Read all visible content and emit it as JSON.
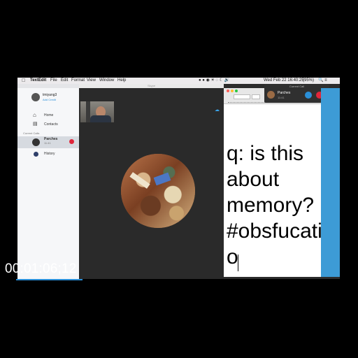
{
  "menubar": {
    "app": "TextEdit",
    "items": [
      "File",
      "Edit",
      "Format",
      "View",
      "Window",
      "Help"
    ],
    "clock": "Wed Feb 22  16:40:25",
    "battery": "(95%)"
  },
  "skype": {
    "window_title": "Skype",
    "user_name": "tmiyang3",
    "user_sub": "Add Credit",
    "nav": [
      {
        "label": "Home"
      },
      {
        "label": "Contacts"
      }
    ],
    "section_label": "Current Calls",
    "call_item": {
      "name": "Parches",
      "time": "11:41"
    },
    "history_label": "History"
  },
  "call_widget": {
    "title": "Current Call",
    "name": "Parches",
    "time": "11:41"
  },
  "textedit": {
    "note_text": "q: is this\nabout\nmemory?\n#obsfucati\no"
  },
  "overlay": {
    "timecode": "00:01:06;12"
  },
  "colors": {
    "menubar": "#eceaec",
    "skype_sidebar": "#f6f7f9",
    "skype_main": "#2a2a2a",
    "accent_blue": "#2a8fd8",
    "end_call_red": "#e0263b"
  }
}
